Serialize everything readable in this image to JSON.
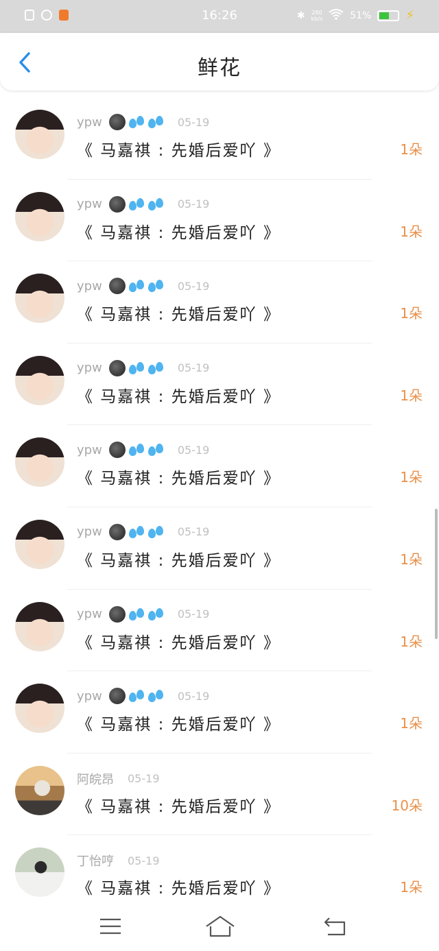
{
  "status_bar": {
    "time": "16:26",
    "net_speed": "280\nkb/s",
    "battery": "51%"
  },
  "header": {
    "title": "鲜花",
    "back_icon": "chevron-left-icon"
  },
  "items": [
    {
      "name": "ypw",
      "date": "05-19",
      "book": "《 马嘉祺 : 先婚后爱吖 》",
      "count": "1朵",
      "emoji": true
    },
    {
      "name": "ypw",
      "date": "05-19",
      "book": "《 马嘉祺 : 先婚后爱吖 》",
      "count": "1朵",
      "emoji": true
    },
    {
      "name": "ypw",
      "date": "05-19",
      "book": "《 马嘉祺 : 先婚后爱吖 》",
      "count": "1朵",
      "emoji": true
    },
    {
      "name": "ypw",
      "date": "05-19",
      "book": "《 马嘉祺 : 先婚后爱吖 》",
      "count": "1朵",
      "emoji": true
    },
    {
      "name": "ypw",
      "date": "05-19",
      "book": "《 马嘉祺 : 先婚后爱吖 》",
      "count": "1朵",
      "emoji": true
    },
    {
      "name": "ypw",
      "date": "05-19",
      "book": "《 马嘉祺 : 先婚后爱吖 》",
      "count": "1朵",
      "emoji": true
    },
    {
      "name": "ypw",
      "date": "05-19",
      "book": "《 马嘉祺 : 先婚后爱吖 》",
      "count": "1朵",
      "emoji": true
    },
    {
      "name": "ypw",
      "date": "05-19",
      "book": "《 马嘉祺 : 先婚后爱吖 》",
      "count": "1朵",
      "emoji": true
    },
    {
      "name": "阿皖昂",
      "date": "05-19",
      "book": "《 马嘉祺 : 先婚后爱吖 》",
      "count": "10朵",
      "emoji": false
    },
    {
      "name": "丁怡哼",
      "date": "05-19",
      "book": "《 马嘉祺 : 先婚后爱吖 》",
      "count": "1朵",
      "emoji": false
    }
  ],
  "colors": {
    "accent": "#2a8ee8",
    "count": "#e8904a"
  },
  "nav": {
    "menu_icon": "menu-icon",
    "home_icon": "home-icon",
    "back_icon": "back-icon"
  }
}
